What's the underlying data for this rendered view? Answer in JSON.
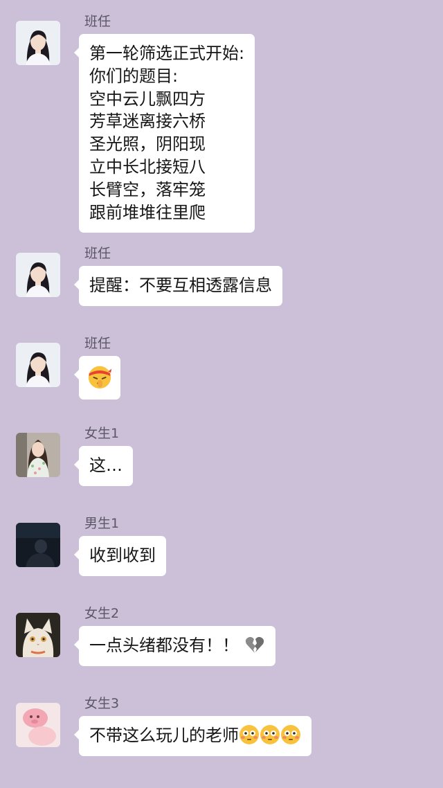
{
  "messages": [
    {
      "sender": "班任",
      "avatar": "woman-portrait-avatar",
      "lines": [
        "第一轮筛选正式开始:",
        "你们的题目:",
        "空中云儿飘四方",
        "芳草迷离接六桥",
        "圣光照，阴阳现",
        "立中长北接短八",
        "长臂空，落牢笼",
        "跟前堆堆往里爬"
      ]
    },
    {
      "sender": "班任",
      "avatar": "woman-portrait-avatar",
      "text": "提醒：不要互相透露信息"
    },
    {
      "sender": "班任",
      "avatar": "woman-portrait-avatar",
      "emoji": "shushing-headband-face-emoji"
    },
    {
      "sender": "女生1",
      "avatar": "girl-floral-dress-avatar",
      "text": "这…"
    },
    {
      "sender": "男生1",
      "avatar": "dark-night-boy-avatar",
      "text": "收到收到"
    },
    {
      "sender": "女生2",
      "avatar": "cat-avatar",
      "text": "一点头绪都没有！！",
      "trailing_emoji": [
        "broken-heart-emoji"
      ]
    },
    {
      "sender": "女生3",
      "avatar": "pink-plush-toy-avatar",
      "text": "不带这么玩儿的老师",
      "trailing_emoji": [
        "flushed-face-emoji",
        "flushed-face-emoji",
        "flushed-face-emoji"
      ]
    }
  ],
  "colors": {
    "background": "#cbc0d8",
    "bubble": "#ffffff",
    "sender_name": "#5b5666",
    "text": "#161616"
  }
}
